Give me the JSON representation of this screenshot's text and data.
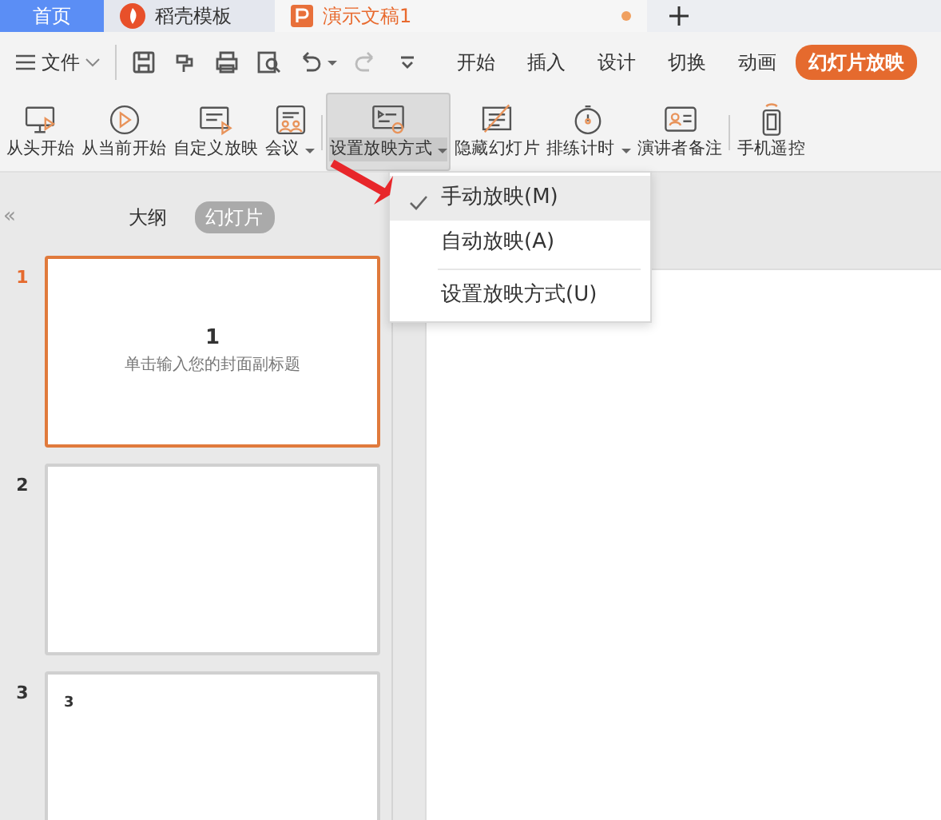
{
  "tabs": [
    {
      "label": "首页",
      "kind": "home",
      "selected": false,
      "modified": false
    },
    {
      "label": "稻壳模板",
      "kind": "template",
      "selected": false,
      "modified": false
    },
    {
      "label": "演示文稿1",
      "kind": "document",
      "selected": true,
      "modified": true
    }
  ],
  "menu_bar": {
    "file_label": "文件",
    "ribbon_tabs": [
      {
        "label": "开始",
        "selected": false
      },
      {
        "label": "插入",
        "selected": false
      },
      {
        "label": "设计",
        "selected": false
      },
      {
        "label": "切换",
        "selected": false
      },
      {
        "label": "动画",
        "selected": false
      },
      {
        "label": "幻灯片放映",
        "selected": true
      }
    ]
  },
  "ribbon": [
    {
      "label": "从头开始",
      "dropdown": false,
      "pressed": false
    },
    {
      "label": "从当前开始",
      "dropdown": false,
      "pressed": false
    },
    {
      "label": "自定义放映",
      "dropdown": false,
      "pressed": false
    },
    {
      "label": "会议",
      "dropdown": true,
      "pressed": false
    },
    {
      "label": "设置放映方式",
      "dropdown": true,
      "pressed": true
    },
    {
      "label": "隐藏幻灯片",
      "dropdown": false,
      "pressed": false
    },
    {
      "label": "排练计时",
      "dropdown": true,
      "pressed": false
    },
    {
      "label": "演讲者备注",
      "dropdown": false,
      "pressed": false
    },
    {
      "label": "手机遥控",
      "dropdown": false,
      "pressed": false
    }
  ],
  "dropdown_menu": [
    {
      "label": "手动放映(M)",
      "checked": true,
      "highlighted": true,
      "separator_before": false
    },
    {
      "label": "自动放映(A)",
      "checked": false,
      "highlighted": false,
      "separator_before": false
    },
    {
      "label": "设置放映方式(U)",
      "checked": false,
      "highlighted": false,
      "separator_before": true
    }
  ],
  "panel": {
    "collapse": "«",
    "view_toggle": [
      {
        "label": "大纲",
        "selected": false
      },
      {
        "label": "幻灯片",
        "selected": true
      }
    ],
    "slides": [
      {
        "number": "1",
        "selected": true,
        "title": "1",
        "subtitle": "单击输入您的封面副标题"
      },
      {
        "number": "2",
        "selected": false
      },
      {
        "number": "3",
        "selected": false,
        "title": "3"
      }
    ]
  }
}
